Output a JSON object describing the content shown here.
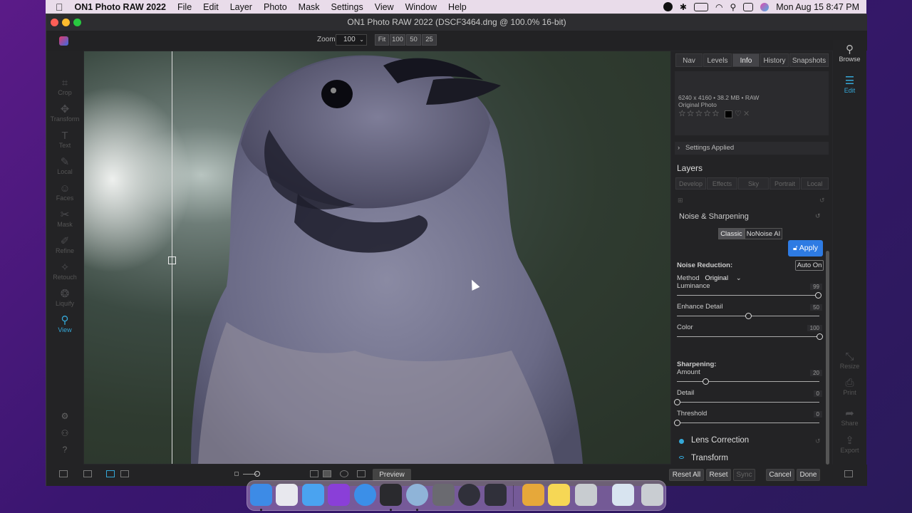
{
  "menubar": {
    "app_name": "ON1 Photo RAW 2022",
    "items": [
      "File",
      "Edit",
      "Layer",
      "Photo",
      "Mask",
      "Settings",
      "View",
      "Window",
      "Help"
    ],
    "clock": "Mon Aug 15  8:47 PM"
  },
  "window": {
    "title": "ON1 Photo RAW 2022 (DSCF3464.dng @ 100.0% 16-bit)"
  },
  "toolbar": {
    "zoom_label": "Zoom",
    "zoom_value": "100",
    "zoom_buttons": [
      "Fit",
      "100",
      "50",
      "25"
    ]
  },
  "left_tools": [
    {
      "label": "Crop",
      "icon": "crop-icon",
      "glyph": "⌗"
    },
    {
      "label": "Transform",
      "icon": "transform-icon",
      "glyph": "✥"
    },
    {
      "label": "Text",
      "icon": "text-icon",
      "glyph": "T"
    },
    {
      "label": "Local",
      "icon": "brush-icon",
      "glyph": "✎"
    },
    {
      "label": "Faces",
      "icon": "face-icon",
      "glyph": "☺"
    },
    {
      "label": "Mask",
      "icon": "mask-icon",
      "glyph": "✂"
    },
    {
      "label": "Refine",
      "icon": "refine-icon",
      "glyph": "✐"
    },
    {
      "label": "Retouch",
      "icon": "retouch-icon",
      "glyph": "✧"
    },
    {
      "label": "Liquify",
      "icon": "liquify-icon",
      "glyph": "❂"
    },
    {
      "label": "View",
      "icon": "view-icon",
      "glyph": "⚲"
    }
  ],
  "panel": {
    "tabs": [
      "Nav",
      "Levels",
      "Info",
      "History",
      "Snapshots"
    ],
    "active_tab": "Info",
    "info_line1": "6240 x 4160  •  38.2 MB  •  RAW",
    "info_line2": "Original Photo",
    "stars": "☆☆☆☆☆",
    "settings_applied": "Settings Applied",
    "layers_title": "Layers",
    "layer_tabs": [
      "Develop",
      "Effects",
      "Sky",
      "Portrait",
      "Local"
    ],
    "section_title": "Noise & Sharpening",
    "mode_classic": "Classic",
    "mode_nonoise": "NoNoise AI",
    "apply_label": "Apply",
    "noise_reduction_label": "Noise Reduction:",
    "auto_on_label": "Auto On",
    "method_label": "Method",
    "method_value": "Original",
    "sharpening_label": "Sharpening:",
    "lens_correction": "Lens Correction",
    "transform": "Transform"
  },
  "sliders": [
    {
      "label": "Luminance",
      "value": "99",
      "fraction": 0.99
    },
    {
      "label": "Enhance Detail",
      "value": "50",
      "fraction": 0.5
    },
    {
      "label": "Color",
      "value": "100",
      "fraction": 1.0
    },
    {
      "label": "Amount",
      "value": "20",
      "fraction": 0.2
    },
    {
      "label": "Detail",
      "value": "0",
      "fraction": 0.0
    },
    {
      "label": "Threshold",
      "value": "0",
      "fraction": 0.0
    }
  ],
  "right_strip": {
    "browse": "Browse",
    "edit": "Edit",
    "resize": "Resize",
    "print": "Print",
    "share": "Share",
    "export": "Export"
  },
  "bottom": {
    "preview": "Preview",
    "reset_all": "Reset All",
    "reset": "Reset",
    "sync": "Sync",
    "cancel": "Cancel",
    "done": "Done"
  },
  "dock_apps": [
    {
      "name": "finder-icon",
      "color": "#3d8be6"
    },
    {
      "name": "launchpad-icon",
      "color": "#e8e8ee"
    },
    {
      "name": "mail-icon",
      "color": "#4aa3f0"
    },
    {
      "name": "affinity-photo-icon",
      "color": "#8a3fd8"
    },
    {
      "name": "safari-icon",
      "color": "#3b8fe8"
    },
    {
      "name": "on1-icon",
      "color": "#2a2a2e"
    },
    {
      "name": "quicktime-icon",
      "color": "#8fb4d8"
    },
    {
      "name": "photo-booth-icon",
      "color": "#6a6a70"
    },
    {
      "name": "obs-icon",
      "color": "#30303a"
    },
    {
      "name": "davinci-icon",
      "color": "#30303a"
    },
    {
      "name": "garageband-icon",
      "color": "#e6a83a"
    },
    {
      "name": "notes-icon",
      "color": "#f6d755"
    },
    {
      "name": "aperture-icon",
      "color": "#c8ccd0"
    },
    {
      "name": "preview-icon",
      "color": "#d8e4f0"
    },
    {
      "name": "trash-icon",
      "color": "#c9cdd2"
    }
  ]
}
